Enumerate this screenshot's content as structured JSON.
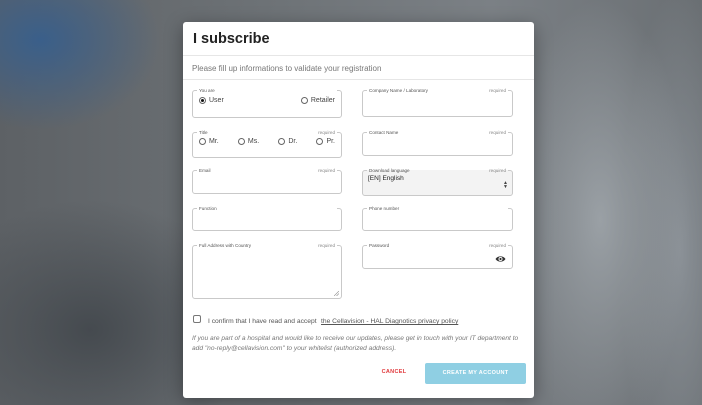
{
  "modal": {
    "title": "I subscribe",
    "subtitle": "Please fill up informations to validate your registration"
  },
  "form": {
    "you_are": {
      "label": "You are",
      "options": [
        "User",
        "Retailer"
      ],
      "selected": "User"
    },
    "company": {
      "label": "Company Name / Laboratory",
      "required": "required",
      "value": ""
    },
    "title": {
      "label": "Title",
      "required": "required",
      "options": [
        "Mr.",
        "Ms.",
        "Dr.",
        "Pr."
      ]
    },
    "contact_name": {
      "label": "Contact Name",
      "required": "required",
      "value": ""
    },
    "email": {
      "label": "Email",
      "required": "required",
      "value": ""
    },
    "download_language": {
      "label": "Download language",
      "required": "required",
      "value": "[EN] English"
    },
    "function": {
      "label": "Function",
      "value": ""
    },
    "phone": {
      "label": "Phone number",
      "value": ""
    },
    "address": {
      "label": "Full Address with Country",
      "required": "required",
      "value": ""
    },
    "password": {
      "label": "Password",
      "required": "required",
      "value": "",
      "icon": "eye-icon"
    }
  },
  "consent": {
    "text": "I confirm that I have read and accept",
    "link": "the Cellavision - HAL Diagnotics privacy policy"
  },
  "notice": "If you are part of a hospital and would like to receive our updates, please get in touch with your IT department to add \"no-reply@cellavision.com\" to your whitelist (authorized address).",
  "buttons": {
    "cancel": "CANCEL",
    "create": "CREATE MY ACCOUNT"
  },
  "colors": {
    "cancel": "#e0373a",
    "create_bg": "#8fcfe3"
  }
}
